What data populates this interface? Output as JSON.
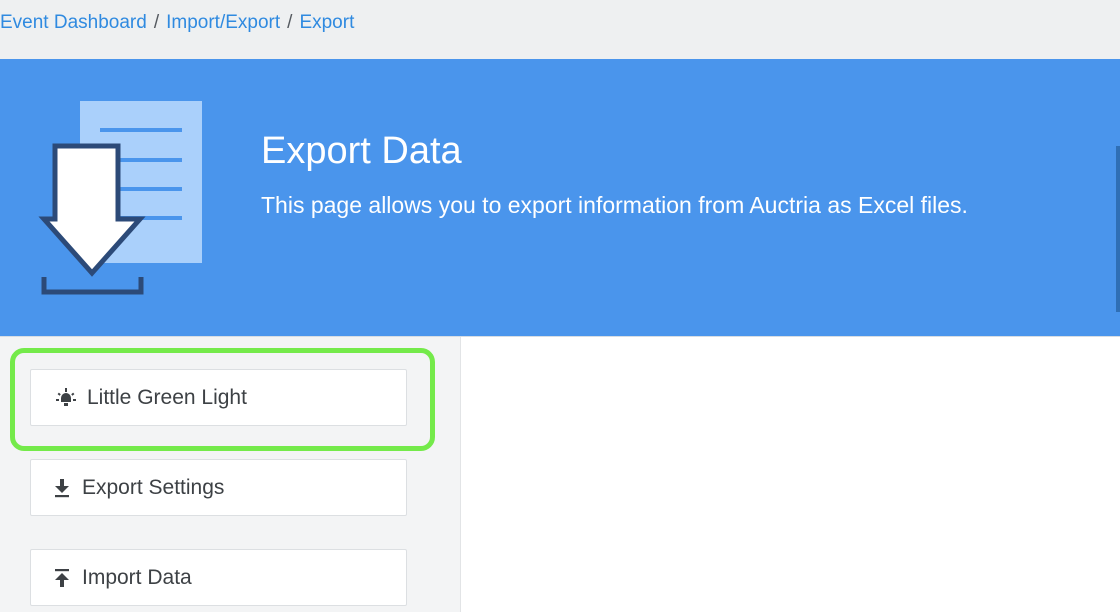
{
  "breadcrumb": {
    "items": [
      {
        "label": "Event Dashboard"
      },
      {
        "label": "Import/Export"
      },
      {
        "label": "Export"
      }
    ],
    "separator": "/"
  },
  "hero": {
    "title": "Export Data",
    "subtitle": "This page allows you to export information from Auctria as Excel files.",
    "icon": "export-download-document-icon",
    "background_color": "#4a95ec"
  },
  "sidebar": {
    "items": [
      {
        "label": "Little Green Light",
        "icon": "light-bulb-icon",
        "highlighted": true
      },
      {
        "label": "Export Settings",
        "icon": "download-icon",
        "highlighted": false
      },
      {
        "label": "Import Data",
        "icon": "upload-icon",
        "highlighted": false
      }
    ]
  },
  "colors": {
    "accent_link": "#2f8ae0",
    "highlight": "#74ea4a"
  }
}
